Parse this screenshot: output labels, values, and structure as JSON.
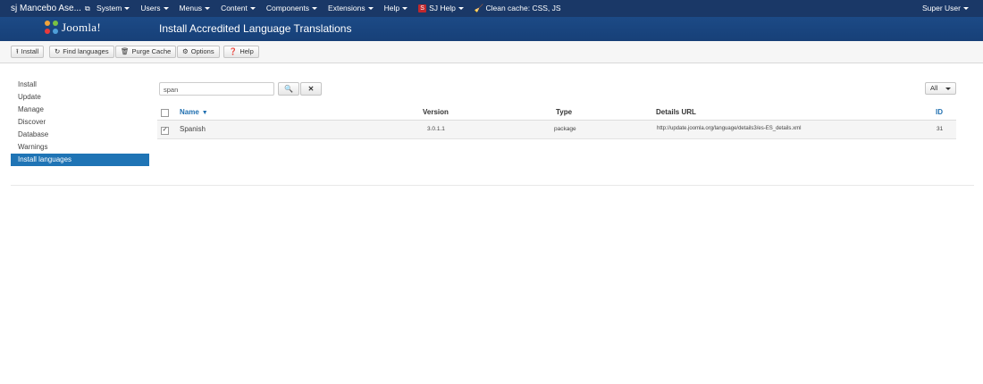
{
  "topnav": {
    "site_name": "sj Mancebo Ase...",
    "ext_icon": "external-link-icon",
    "items": [
      {
        "label": "System"
      },
      {
        "label": "Users"
      },
      {
        "label": "Menus"
      },
      {
        "label": "Content"
      },
      {
        "label": "Components"
      },
      {
        "label": "Extensions"
      },
      {
        "label": "Help"
      }
    ],
    "sj_help": "SJ Help",
    "clean_cache": "Clean cache: CSS, JS",
    "user": "Super User"
  },
  "header": {
    "logo_text": "Joomla!",
    "title": "Install Accredited Language Translations"
  },
  "toolbar": {
    "install": "Install",
    "find": "Find languages",
    "purge": "Purge Cache",
    "options": "Options",
    "help": "Help"
  },
  "sidebar": {
    "items": [
      {
        "label": "Install"
      },
      {
        "label": "Update"
      },
      {
        "label": "Manage"
      },
      {
        "label": "Discover"
      },
      {
        "label": "Database"
      },
      {
        "label": "Warnings"
      },
      {
        "label": "Install languages"
      }
    ],
    "active_index": 6
  },
  "filter": {
    "search_value": "span",
    "limit_value": "All"
  },
  "table": {
    "headers": {
      "name": "Name",
      "version": "Version",
      "type": "Type",
      "details_url": "Details URL",
      "id": "ID"
    },
    "rows": [
      {
        "checked": true,
        "name": "Spanish",
        "version": "3.0.1.1",
        "type": "package",
        "details_url": "http://update.joomla.org/language/details3/es-ES_details.xml",
        "id": "31"
      }
    ]
  },
  "colors": {
    "nav_bg": "#1a3867",
    "header_bg": "#1c4a86",
    "active_sidebar": "#1f74b5",
    "link": "#1f6fb0"
  }
}
